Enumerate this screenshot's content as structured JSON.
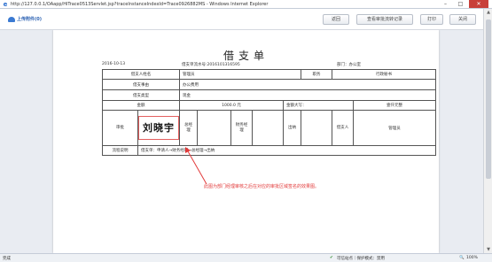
{
  "window": {
    "title": "http://127.0.0.1/OAapp/HiTrace0513Servlet.jsp?traceInstanceIndexId=Trace0926882MS - Windows Internet Explorer",
    "min": "–",
    "max": "□",
    "close": "✕"
  },
  "toolbar": {
    "upload_label": "上传附件(0)",
    "back_label": "返回",
    "approval_record_label": "查看审批流转记录",
    "print_label": "打印",
    "close_label": "关闭"
  },
  "form": {
    "title": "借支单",
    "date": "2016-10-13",
    "serial": "借支单流水号:2016101316595",
    "dept": "部门：办公室",
    "rows": {
      "applicant_label": "借支人姓名",
      "applicant_value": "管理员",
      "position_label": "职务",
      "position_value": "行政秘书",
      "reason_label": "借支事由",
      "reason_value": "办公费用",
      "type_label": "借支类型",
      "type_value": "现金",
      "amount_label": "金额",
      "amount_value": "1000.0 元",
      "amount_upper_label": "金额大写：",
      "amount_upper_value": "壹仟元整",
      "approval_label": "审批",
      "signature": "刘晓宇",
      "dept_manager_label": "总经理",
      "finance_label": "财务经理",
      "cashier_label": "出纳",
      "borrower_label": "借支人",
      "borrower_value": "管理员",
      "flow_label": "流程说明",
      "flow_value": "借支单：申请人→财务经理→总经理→出纳"
    }
  },
  "annotation": {
    "note": "此图为部门经理审核之后在对应的审批区域签名的效果图。",
    "color": "#e23b3b"
  },
  "statusbar": {
    "left": "完成",
    "zone": "可信站点｜保护模式：禁用",
    "zoom": "100%"
  }
}
